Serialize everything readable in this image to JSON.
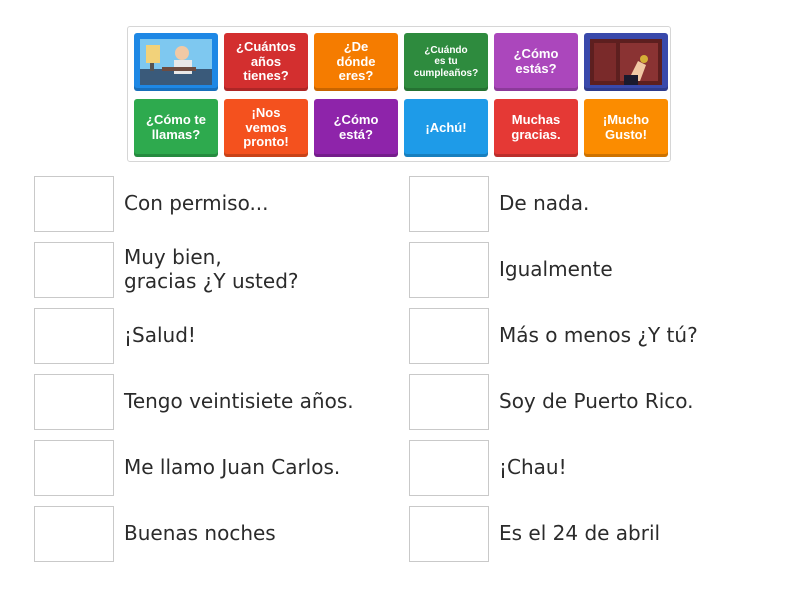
{
  "bank": {
    "tiles": [
      {
        "label": "",
        "color": "#1e88e5",
        "icon": "man-at-desk-image"
      },
      {
        "label": "¿Cuántos\naños\ntienes?",
        "color": "#d32f2f"
      },
      {
        "label": "¿De\ndónde\neres?",
        "color": "#f57c00"
      },
      {
        "label": "¿Cuándo\nes tu\ncumpleaños?",
        "color": "#2e8b3e"
      },
      {
        "label": "¿Cómo\nestás?",
        "color": "#ab47bc"
      },
      {
        "label": "",
        "color": "#3949ab",
        "icon": "hand-knocking-door-image"
      },
      {
        "label": "¿Cómo te\nllamas?",
        "color": "#2eaa4e"
      },
      {
        "label": "¡Nos\nvemos\npronto!",
        "color": "#f4511e"
      },
      {
        "label": "¿Cómo\nestá?",
        "color": "#8e24aa"
      },
      {
        "label": "¡Achú!",
        "color": "#1e9be8"
      },
      {
        "label": "Muchas\ngracias.",
        "color": "#e53935"
      },
      {
        "label": "¡Mucho\nGusto!",
        "color": "#fb8c00"
      }
    ]
  },
  "answers": {
    "left": [
      "Con permiso...",
      "Muy bien,\ngracias ¿Y usted?",
      "¡Salud!",
      "Tengo veintisiete años.",
      "Me llamo Juan Carlos.",
      "Buenas noches"
    ],
    "right": [
      "De nada.",
      "Igualmente",
      "Más o menos ¿Y tú?",
      "Soy de Puerto Rico.",
      "¡Chau!",
      "Es el 24 de abril"
    ]
  }
}
